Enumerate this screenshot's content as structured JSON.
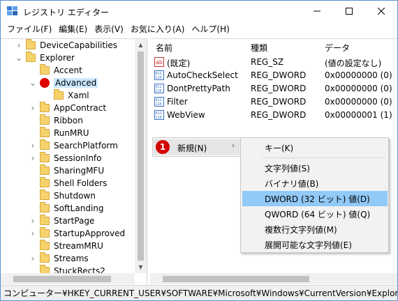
{
  "window": {
    "title": "レジストリ エディター",
    "controls": {
      "minimize": "–",
      "maximize": "□",
      "close": "✕"
    }
  },
  "menubar": {
    "items": [
      "ファイル(F)",
      "編集(E)",
      "表示(V)",
      "お気に入り(A)",
      "ヘルプ(H)"
    ]
  },
  "tree": {
    "items": [
      {
        "label": "DeviceCapabilities",
        "expander": "›",
        "icon": "folder-icon"
      },
      {
        "label": "Explorer",
        "expander": "⌄",
        "icon": "folder-icon"
      },
      {
        "label": "Accent",
        "expander": "",
        "icon": "folder-icon"
      },
      {
        "label": "Advanced",
        "expander": "⌄",
        "icon": "red-dot-marker",
        "selected": true
      },
      {
        "label": "Xaml",
        "expander": "",
        "icon": "folder-icon"
      },
      {
        "label": "AppContract",
        "expander": "›",
        "icon": "folder-icon"
      },
      {
        "label": "Ribbon",
        "expander": "",
        "icon": "folder-icon"
      },
      {
        "label": "RunMRU",
        "expander": "",
        "icon": "folder-icon"
      },
      {
        "label": "SearchPlatform",
        "expander": "›",
        "icon": "folder-icon"
      },
      {
        "label": "SessionInfo",
        "expander": "›",
        "icon": "folder-icon"
      },
      {
        "label": "SharingMFU",
        "expander": "",
        "icon": "folder-icon"
      },
      {
        "label": "Shell Folders",
        "expander": "",
        "icon": "folder-icon"
      },
      {
        "label": "Shutdown",
        "expander": "",
        "icon": "folder-icon"
      },
      {
        "label": "SoftLanding",
        "expander": "",
        "icon": "folder-icon"
      },
      {
        "label": "StartPage",
        "expander": "›",
        "icon": "folder-icon"
      },
      {
        "label": "StartupApproved",
        "expander": "›",
        "icon": "folder-icon"
      },
      {
        "label": "StreamMRU",
        "expander": "",
        "icon": "folder-icon"
      },
      {
        "label": "Streams",
        "expander": "›",
        "icon": "folder-icon"
      },
      {
        "label": "StuckRects2",
        "expander": "",
        "icon": "folder-icon"
      }
    ]
  },
  "list": {
    "headers": {
      "name": "名前",
      "type": "種類",
      "data": "データ"
    },
    "rows": [
      {
        "name": "(既定)",
        "type": "REG_SZ",
        "data": "(値の設定なし)",
        "icon": "string-value-icon"
      },
      {
        "name": "AutoCheckSelect",
        "type": "REG_DWORD",
        "data": "0x00000000 (0)",
        "icon": "binary-value-icon"
      },
      {
        "name": "DontPrettyPath",
        "type": "REG_DWORD",
        "data": "0x00000000 (0)",
        "icon": "binary-value-icon"
      },
      {
        "name": "Filter",
        "type": "REG_DWORD",
        "data": "0x00000000 (0)",
        "icon": "binary-value-icon"
      },
      {
        "name": "WebView",
        "type": "REG_DWORD",
        "data": "0x00000001 (1)",
        "icon": "binary-value-icon"
      }
    ]
  },
  "context_menu": {
    "step_badge": "1",
    "new_label": "新規(N)",
    "submenu_arrow": "›"
  },
  "submenu": {
    "items": [
      "キー(K)",
      "文字列値(S)",
      "バイナリ値(B)",
      "DWORD (32 ビット) 値(D)",
      "QWORD (64 ビット) 値(Q)",
      "複数行文字列値(M)",
      "展開可能な文字列値(E)"
    ],
    "highlighted_index": 3
  },
  "statusbar": {
    "path": "コンピューター¥HKEY_CURRENT_USER¥SOFTWARE¥Microsoft¥Windows¥CurrentVersion¥Explorer¥Advanced"
  },
  "colors": {
    "selection": "#cce8ff",
    "menu_highlight": "#91c9f7",
    "badge_red": "#d30000"
  }
}
